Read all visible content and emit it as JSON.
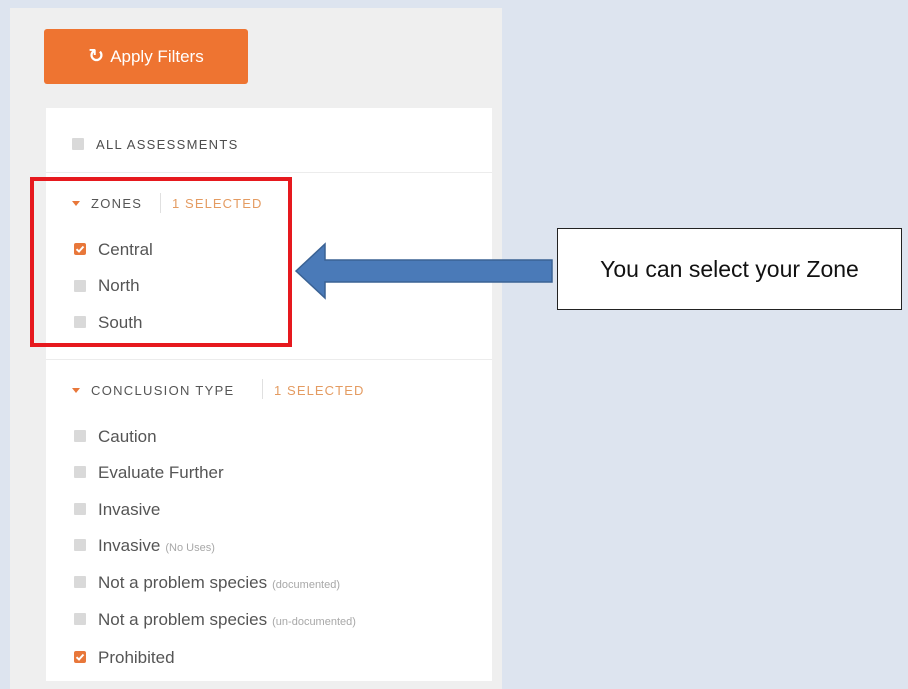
{
  "apply_button": {
    "icon": "refresh-icon",
    "label": "Apply Filters",
    "color": "#ee7431"
  },
  "all_assessments": {
    "label": "ALL ASSESSMENTS",
    "checked": false
  },
  "zones": {
    "title": "ZONES",
    "selected_text": "1 SELECTED",
    "options": [
      {
        "label": "Central",
        "checked": true
      },
      {
        "label": "North",
        "checked": false
      },
      {
        "label": "South",
        "checked": false
      }
    ]
  },
  "conclusion_type": {
    "title": "CONCLUSION TYPE",
    "selected_text": "1 SELECTED",
    "options": [
      {
        "label": "Caution",
        "sub": "",
        "checked": false
      },
      {
        "label": "Evaluate Further",
        "sub": "",
        "checked": false
      },
      {
        "label": "Invasive",
        "sub": "",
        "checked": false
      },
      {
        "label": "Invasive",
        "sub": "(No Uses)",
        "checked": false
      },
      {
        "label": "Not a problem species",
        "sub": "(documented)",
        "checked": false
      },
      {
        "label": "Not a problem species",
        "sub": "(un-documented)",
        "checked": false
      },
      {
        "label": "Prohibited",
        "sub": "",
        "checked": true
      }
    ]
  },
  "annotation": {
    "callout_text": "You can select your  Zone",
    "arrow_color": "#4a7ab8",
    "highlight_color": "#e6191e"
  },
  "colors": {
    "accent": "#e8773a",
    "background": "#dde4ef"
  }
}
